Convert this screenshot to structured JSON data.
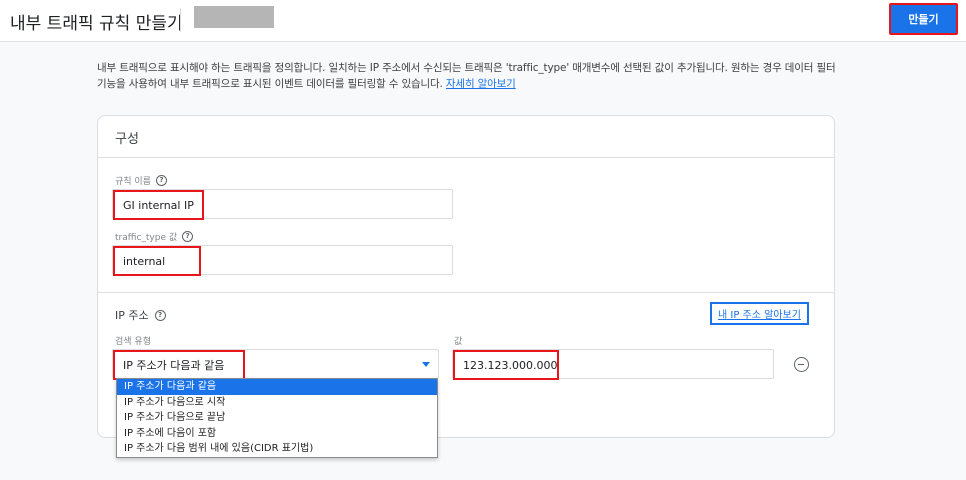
{
  "header": {
    "title": "내부 트래픽 규칙 만들기",
    "create_label": "만들기"
  },
  "description": {
    "text": "내부 트래픽으로 표시해야 하는 트래픽을 정의합니다. 일치하는 IP 주소에서 수신되는 트래픽은 'traffic_type' 매개변수에 선택된 값이 추가됩니다. 원하는 경우 데이터 필터 기능을 사용하여 내부 트래픽으로 표시된 이벤트 데이터를 필터링할 수 있습니다.",
    "learn_more": "자세히 알아보기"
  },
  "config": {
    "title": "구성",
    "rule_name": {
      "label": "규칙 이름",
      "value": "GI internal IP"
    },
    "traffic_type": {
      "label": "traffic_type 값",
      "value": "internal"
    },
    "ip": {
      "section_title": "IP 주소",
      "find_ip_link": "내 IP 주소 알아보기",
      "match_type_label": "검색 유형",
      "match_type_value": "IP 주소가 다음과 같음",
      "value_label": "값",
      "value": "123.123.000.000",
      "options": [
        "IP 주소가 다음과 같음",
        "IP 주소가 다음으로 시작",
        "IP 주소가 다음으로 끝남",
        "IP 주소에 다음이 포함",
        "IP 주소가 다음 범위 내에 있음(CIDR 표기법)"
      ]
    }
  },
  "colors": {
    "accent": "#1a73e8",
    "highlight": "#e8151b"
  }
}
